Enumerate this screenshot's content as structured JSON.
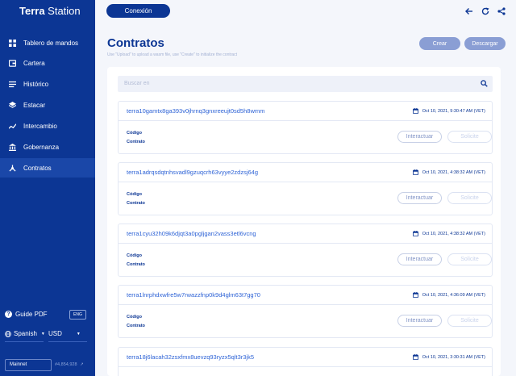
{
  "app": {
    "logo_bold": "Terra",
    "logo_rest": " Station"
  },
  "sidebar": {
    "items": [
      {
        "label": "Tablero de mandos",
        "icon": "dashboard-icon"
      },
      {
        "label": "Cartera",
        "icon": "wallet-icon"
      },
      {
        "label": "Histórico",
        "icon": "history-icon"
      },
      {
        "label": "Estacar",
        "icon": "stake-icon"
      },
      {
        "label": "Intercambio",
        "icon": "swap-icon"
      },
      {
        "label": "Gobernanza",
        "icon": "governance-icon"
      },
      {
        "label": "Contratos",
        "icon": "contracts-icon",
        "active": true
      }
    ],
    "guide": "Guide PDF",
    "lang_badge": "ENG",
    "language": "Spanish",
    "currency": "USD",
    "network": "Mainnet",
    "block": "#4,854,928"
  },
  "topbar": {
    "connect": "Conexión"
  },
  "header": {
    "title": "Contratos",
    "desc": "Use \"Upload\" to upload a wasm file, use \"Create\" to initialize the contract",
    "create": "Crear",
    "download": "Descargar"
  },
  "search": {
    "placeholder": "Buscar en"
  },
  "contracts": [
    {
      "address": "terra10gamtx8ga393v0jhrnq3gnxreeujt0sd5h8wmm",
      "date": "Oct 10, 2021, 9:30:47 AM (VET)"
    },
    {
      "address": "terra1adrqsdqtnhsvadl9gzuqcrh63vyye2zdzsj64g",
      "date": "Oct 10, 2021, 4:38:32 AM (VET)"
    },
    {
      "address": "terra1cyu32h09k6djqt3a0pgljgan2vass3etl6vcng",
      "date": "Oct 10, 2021, 4:38:32 AM (VET)"
    },
    {
      "address": "terra1lnrphdxwfre5w7rwazzfnp0k9d4glm63t7gg70",
      "date": "Oct 10, 2021, 4:36:09 AM (VET)"
    },
    {
      "address": "terra18j6lacah32zsxfmx8uevzq93ryzx5qlt3r3jk5",
      "date": "Oct 10, 2021, 3:30:31 AM (VET)"
    }
  ],
  "card_labels": {
    "code": "Código",
    "contract": "Contrato",
    "interact": "Interactuar",
    "query": "Solicite"
  },
  "colors": {
    "primary": "#0c3694",
    "link": "#2e63d6",
    "button_muted": "#8a9ed4"
  }
}
